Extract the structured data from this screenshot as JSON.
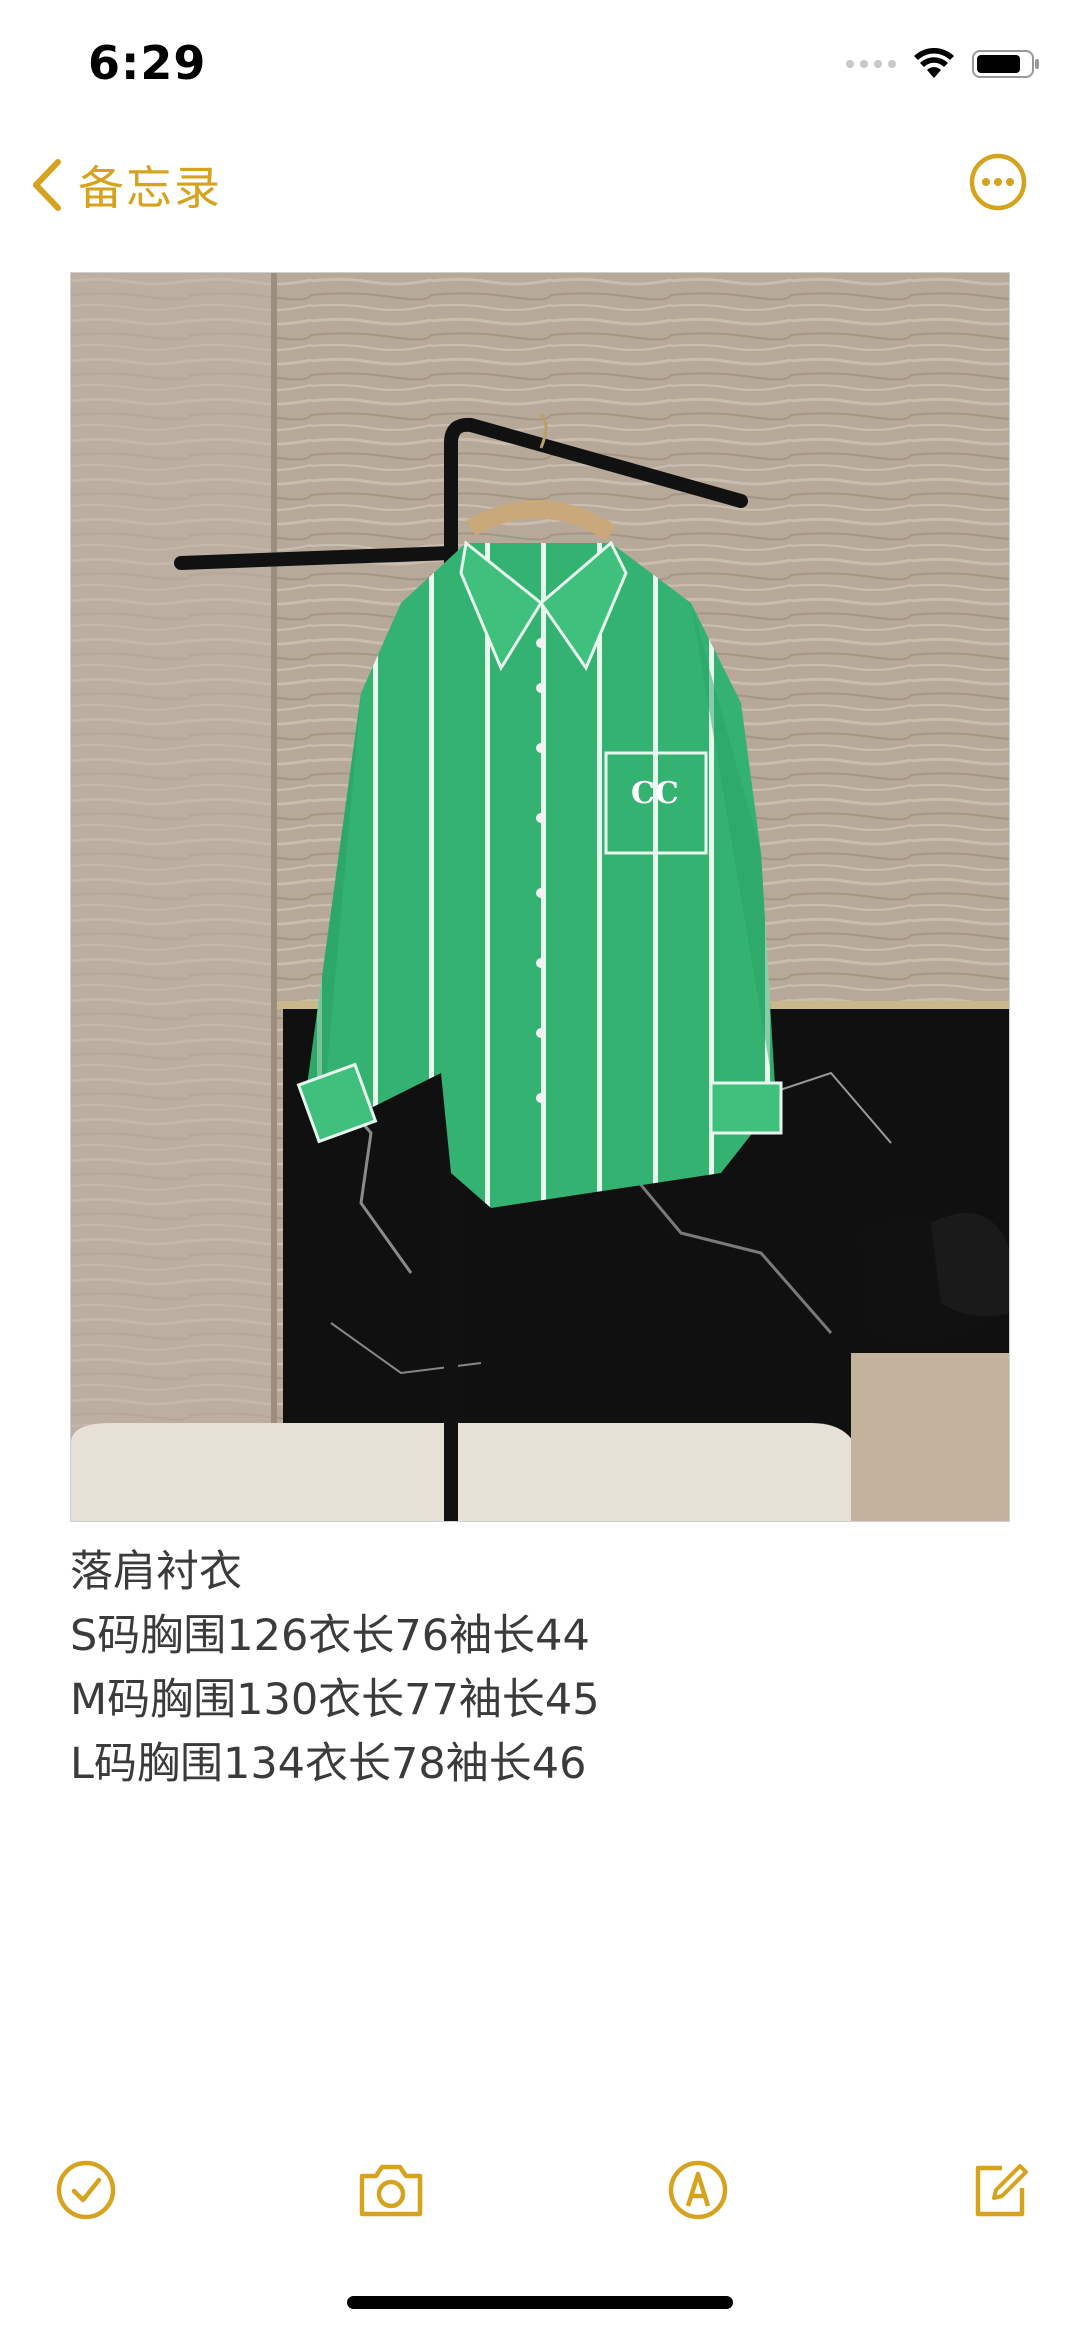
{
  "status_bar": {
    "time": "6:29"
  },
  "nav": {
    "back_label": "备忘录",
    "back_icon": "chevron-left-icon",
    "more_icon": "ellipsis-circle-icon"
  },
  "note": {
    "photo_icon": "photo-green-striped-shirt",
    "lines": [
      "落肩衬衣",
      "S码胸围126衣长76袖长44",
      "M码胸围130衣长77袖长45",
      "L码胸围134衣长78袖长46"
    ]
  },
  "toolbar": {
    "items": [
      "checklist-icon",
      "camera-icon",
      "markup-icon",
      "compose-icon"
    ]
  },
  "colors": {
    "accent": "#d6a31f",
    "text": "#3b3b3b"
  }
}
